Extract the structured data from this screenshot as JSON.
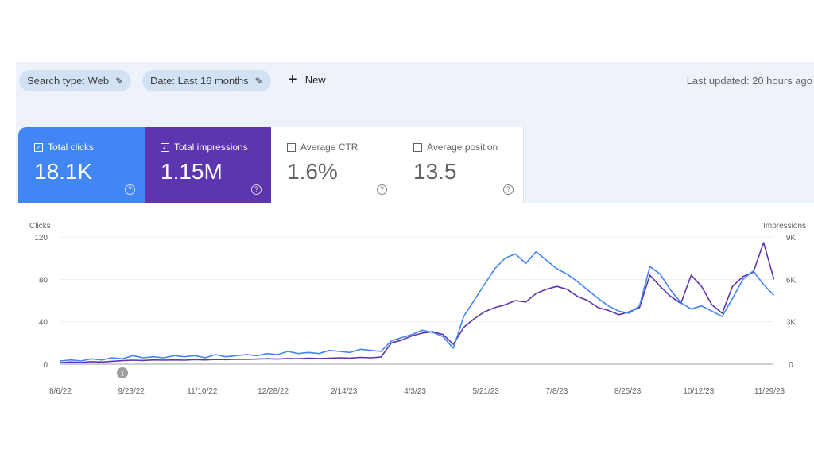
{
  "filters": {
    "search_type": "Search type: Web",
    "date": "Date: Last 16 months",
    "new_label": "New",
    "last_updated": "Last updated: 20 hours ago"
  },
  "colors": {
    "clicks": "#4285f4",
    "impressions": "#5e35b1"
  },
  "metrics": [
    {
      "label": "Total clicks",
      "value": "18.1K",
      "checked": true
    },
    {
      "label": "Total impressions",
      "value": "1.15M",
      "checked": true
    },
    {
      "label": "Average CTR",
      "value": "1.6%",
      "checked": false
    },
    {
      "label": "Average position",
      "value": "13.5",
      "checked": false
    }
  ],
  "chart_data": {
    "type": "line",
    "left_axis_label": "Clicks",
    "right_axis_label": "Impressions",
    "left_ylim": [
      0,
      120
    ],
    "right_ylim": [
      0,
      9000
    ],
    "left_ticks": [
      "0",
      "40",
      "80",
      "120"
    ],
    "right_ticks": [
      "0",
      "3K",
      "6K",
      "9K"
    ],
    "x_ticks": [
      "8/6/22",
      "9/23/22",
      "11/10/22",
      "12/28/22",
      "2/14/23",
      "4/3/23",
      "5/21/23",
      "7/8/23",
      "8/25/23",
      "10/12/23",
      "11/29/23"
    ],
    "annotation": {
      "date": "9/17/22",
      "label": "1"
    },
    "grid": true,
    "x": [
      "8/6/22",
      "8/13/22",
      "8/20/22",
      "8/27/22",
      "9/3/22",
      "9/10/22",
      "9/17/22",
      "9/24/22",
      "10/1/22",
      "10/8/22",
      "10/15/22",
      "10/22/22",
      "10/29/22",
      "11/5/22",
      "11/12/22",
      "11/19/22",
      "11/26/22",
      "12/3/22",
      "12/10/22",
      "12/17/22",
      "12/24/22",
      "12/31/22",
      "1/7/23",
      "1/14/23",
      "1/21/23",
      "1/28/23",
      "2/4/23",
      "2/11/23",
      "2/18/23",
      "2/25/23",
      "3/4/23",
      "3/11/23",
      "3/18/23",
      "3/25/23",
      "4/1/23",
      "4/8/23",
      "4/15/23",
      "4/22/23",
      "4/29/23",
      "5/6/23",
      "5/13/23",
      "5/20/23",
      "5/27/23",
      "6/3/23",
      "6/10/23",
      "6/17/23",
      "6/24/23",
      "7/1/23",
      "7/8/23",
      "7/15/23",
      "7/22/23",
      "7/29/23",
      "8/5/23",
      "8/12/23",
      "8/19/23",
      "8/26/23",
      "9/2/23",
      "9/9/23",
      "9/16/23",
      "9/23/23",
      "9/30/23",
      "10/7/23",
      "10/14/23",
      "10/21/23",
      "10/28/23",
      "11/4/23",
      "11/11/23",
      "11/18/23",
      "11/25/23",
      "12/2/23"
    ],
    "series": [
      {
        "name": "Clicks",
        "axis": "left",
        "values": [
          3,
          4,
          3,
          5,
          4,
          6,
          5,
          8,
          6,
          7,
          6,
          8,
          7,
          8,
          6,
          9,
          7,
          8,
          9,
          8,
          10,
          9,
          12,
          10,
          11,
          10,
          13,
          12,
          11,
          14,
          13,
          12,
          22,
          25,
          28,
          32,
          30,
          26,
          15,
          45,
          60,
          75,
          90,
          100,
          104,
          95,
          106,
          98,
          90,
          85,
          78,
          70,
          62,
          55,
          50,
          48,
          55,
          92,
          85,
          70,
          58,
          52,
          55,
          50,
          45,
          62,
          80,
          88,
          75,
          65
        ]
      },
      {
        "name": "Impressions",
        "axis": "right",
        "values": [
          100,
          150,
          120,
          180,
          150,
          200,
          250,
          280,
          260,
          300,
          280,
          300,
          280,
          320,
          300,
          330,
          320,
          350,
          340,
          360,
          380,
          360,
          400,
          380,
          420,
          400,
          420,
          450,
          430,
          480,
          450,
          500,
          1500,
          1700,
          2000,
          2200,
          2300,
          2100,
          1400,
          2600,
          3200,
          3700,
          4000,
          4200,
          4500,
          4400,
          5000,
          5300,
          5500,
          5300,
          4800,
          4500,
          4000,
          3800,
          3500,
          3700,
          4000,
          6300,
          5500,
          4800,
          4300,
          6300,
          5500,
          4200,
          3600,
          5500,
          6200,
          6500,
          8600,
          6000
        ]
      }
    ]
  }
}
